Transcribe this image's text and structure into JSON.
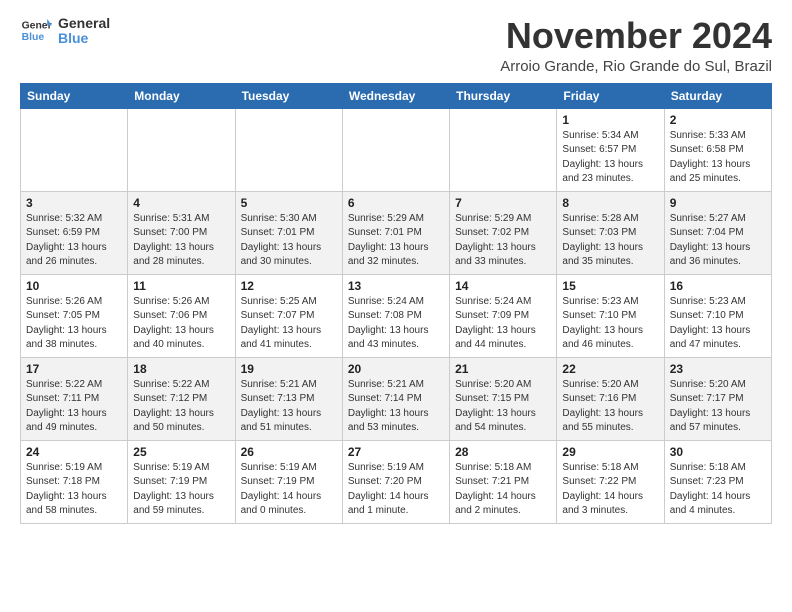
{
  "header": {
    "logo_line1": "General",
    "logo_line2": "Blue",
    "month_year": "November 2024",
    "location": "Arroio Grande, Rio Grande do Sul, Brazil"
  },
  "weekdays": [
    "Sunday",
    "Monday",
    "Tuesday",
    "Wednesday",
    "Thursday",
    "Friday",
    "Saturday"
  ],
  "weeks": [
    [
      {
        "day": "",
        "info": ""
      },
      {
        "day": "",
        "info": ""
      },
      {
        "day": "",
        "info": ""
      },
      {
        "day": "",
        "info": ""
      },
      {
        "day": "",
        "info": ""
      },
      {
        "day": "1",
        "info": "Sunrise: 5:34 AM\nSunset: 6:57 PM\nDaylight: 13 hours\nand 23 minutes."
      },
      {
        "day": "2",
        "info": "Sunrise: 5:33 AM\nSunset: 6:58 PM\nDaylight: 13 hours\nand 25 minutes."
      }
    ],
    [
      {
        "day": "3",
        "info": "Sunrise: 5:32 AM\nSunset: 6:59 PM\nDaylight: 13 hours\nand 26 minutes."
      },
      {
        "day": "4",
        "info": "Sunrise: 5:31 AM\nSunset: 7:00 PM\nDaylight: 13 hours\nand 28 minutes."
      },
      {
        "day": "5",
        "info": "Sunrise: 5:30 AM\nSunset: 7:01 PM\nDaylight: 13 hours\nand 30 minutes."
      },
      {
        "day": "6",
        "info": "Sunrise: 5:29 AM\nSunset: 7:01 PM\nDaylight: 13 hours\nand 32 minutes."
      },
      {
        "day": "7",
        "info": "Sunrise: 5:29 AM\nSunset: 7:02 PM\nDaylight: 13 hours\nand 33 minutes."
      },
      {
        "day": "8",
        "info": "Sunrise: 5:28 AM\nSunset: 7:03 PM\nDaylight: 13 hours\nand 35 minutes."
      },
      {
        "day": "9",
        "info": "Sunrise: 5:27 AM\nSunset: 7:04 PM\nDaylight: 13 hours\nand 36 minutes."
      }
    ],
    [
      {
        "day": "10",
        "info": "Sunrise: 5:26 AM\nSunset: 7:05 PM\nDaylight: 13 hours\nand 38 minutes."
      },
      {
        "day": "11",
        "info": "Sunrise: 5:26 AM\nSunset: 7:06 PM\nDaylight: 13 hours\nand 40 minutes."
      },
      {
        "day": "12",
        "info": "Sunrise: 5:25 AM\nSunset: 7:07 PM\nDaylight: 13 hours\nand 41 minutes."
      },
      {
        "day": "13",
        "info": "Sunrise: 5:24 AM\nSunset: 7:08 PM\nDaylight: 13 hours\nand 43 minutes."
      },
      {
        "day": "14",
        "info": "Sunrise: 5:24 AM\nSunset: 7:09 PM\nDaylight: 13 hours\nand 44 minutes."
      },
      {
        "day": "15",
        "info": "Sunrise: 5:23 AM\nSunset: 7:10 PM\nDaylight: 13 hours\nand 46 minutes."
      },
      {
        "day": "16",
        "info": "Sunrise: 5:23 AM\nSunset: 7:10 PM\nDaylight: 13 hours\nand 47 minutes."
      }
    ],
    [
      {
        "day": "17",
        "info": "Sunrise: 5:22 AM\nSunset: 7:11 PM\nDaylight: 13 hours\nand 49 minutes."
      },
      {
        "day": "18",
        "info": "Sunrise: 5:22 AM\nSunset: 7:12 PM\nDaylight: 13 hours\nand 50 minutes."
      },
      {
        "day": "19",
        "info": "Sunrise: 5:21 AM\nSunset: 7:13 PM\nDaylight: 13 hours\nand 51 minutes."
      },
      {
        "day": "20",
        "info": "Sunrise: 5:21 AM\nSunset: 7:14 PM\nDaylight: 13 hours\nand 53 minutes."
      },
      {
        "day": "21",
        "info": "Sunrise: 5:20 AM\nSunset: 7:15 PM\nDaylight: 13 hours\nand 54 minutes."
      },
      {
        "day": "22",
        "info": "Sunrise: 5:20 AM\nSunset: 7:16 PM\nDaylight: 13 hours\nand 55 minutes."
      },
      {
        "day": "23",
        "info": "Sunrise: 5:20 AM\nSunset: 7:17 PM\nDaylight: 13 hours\nand 57 minutes."
      }
    ],
    [
      {
        "day": "24",
        "info": "Sunrise: 5:19 AM\nSunset: 7:18 PM\nDaylight: 13 hours\nand 58 minutes."
      },
      {
        "day": "25",
        "info": "Sunrise: 5:19 AM\nSunset: 7:19 PM\nDaylight: 13 hours\nand 59 minutes."
      },
      {
        "day": "26",
        "info": "Sunrise: 5:19 AM\nSunset: 7:19 PM\nDaylight: 14 hours\nand 0 minutes."
      },
      {
        "day": "27",
        "info": "Sunrise: 5:19 AM\nSunset: 7:20 PM\nDaylight: 14 hours\nand 1 minute."
      },
      {
        "day": "28",
        "info": "Sunrise: 5:18 AM\nSunset: 7:21 PM\nDaylight: 14 hours\nand 2 minutes."
      },
      {
        "day": "29",
        "info": "Sunrise: 5:18 AM\nSunset: 7:22 PM\nDaylight: 14 hours\nand 3 minutes."
      },
      {
        "day": "30",
        "info": "Sunrise: 5:18 AM\nSunset: 7:23 PM\nDaylight: 14 hours\nand 4 minutes."
      }
    ]
  ]
}
